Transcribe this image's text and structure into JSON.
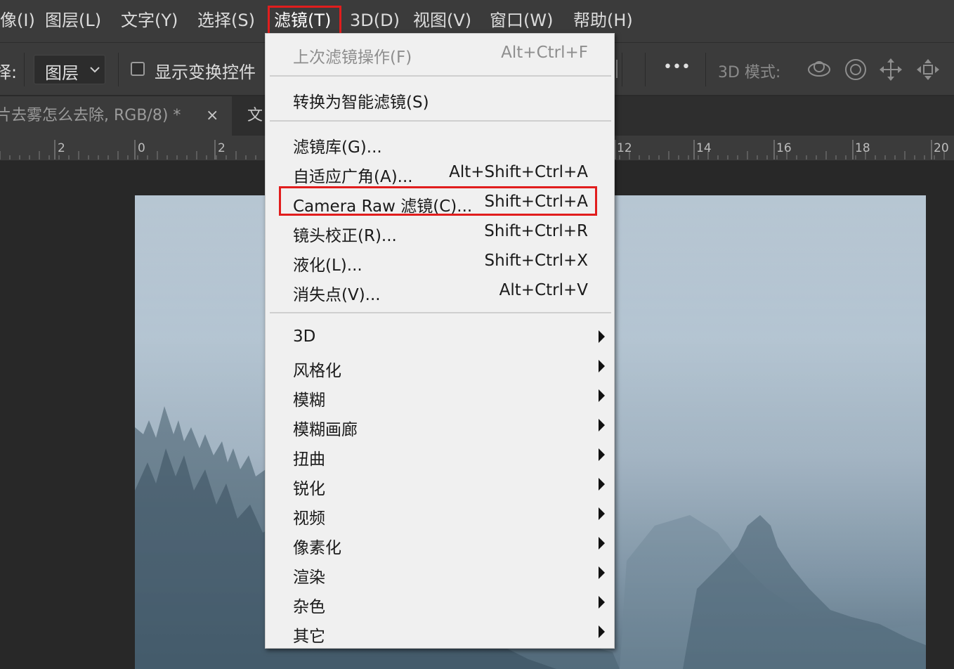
{
  "menubar": {
    "items": [
      "像(I)",
      "图层(L)",
      "文字(Y)",
      "选择(S)",
      "滤镜(T)",
      "3D(D)",
      "视图(V)",
      "窗口(W)",
      "帮助(H)"
    ]
  },
  "options": {
    "prefix": "择:",
    "layer_select": "图层",
    "show_transform": "显示变换控件",
    "more": "•••",
    "mode_label": "3D 模式:"
  },
  "tabs": {
    "active": "片去雾怎么去除, RGB/8) *",
    "close": "×",
    "second": "文"
  },
  "ruler": {
    "labels": [
      "2",
      "0",
      "2",
      "12",
      "14",
      "16",
      "18",
      "20"
    ]
  },
  "filter_menu": {
    "last_filter": {
      "label": "上次滤镜操作(F)",
      "shortcut": "Alt+Ctrl+F"
    },
    "convert_smart": {
      "label": "转换为智能滤镜(S)"
    },
    "gallery": {
      "label": "滤镜库(G)..."
    },
    "adaptive_wide": {
      "label": "自适应广角(A)...",
      "shortcut": "Alt+Shift+Ctrl+A"
    },
    "camera_raw": {
      "label": "Camera Raw 滤镜(C)...",
      "shortcut": "Shift+Ctrl+A"
    },
    "lens_correction": {
      "label": "镜头校正(R)...",
      "shortcut": "Shift+Ctrl+R"
    },
    "liquify": {
      "label": "液化(L)...",
      "shortcut": "Shift+Ctrl+X"
    },
    "vanishing_point": {
      "label": "消失点(V)...",
      "shortcut": "Alt+Ctrl+V"
    },
    "submenus": [
      "3D",
      "风格化",
      "模糊",
      "模糊画廊",
      "扭曲",
      "锐化",
      "视频",
      "像素化",
      "渲染",
      "杂色",
      "其它"
    ]
  },
  "colors": {
    "highlight": "#e11d1d",
    "menu_bg": "#f0f0f0",
    "app_bg": "#3b3b3b"
  }
}
